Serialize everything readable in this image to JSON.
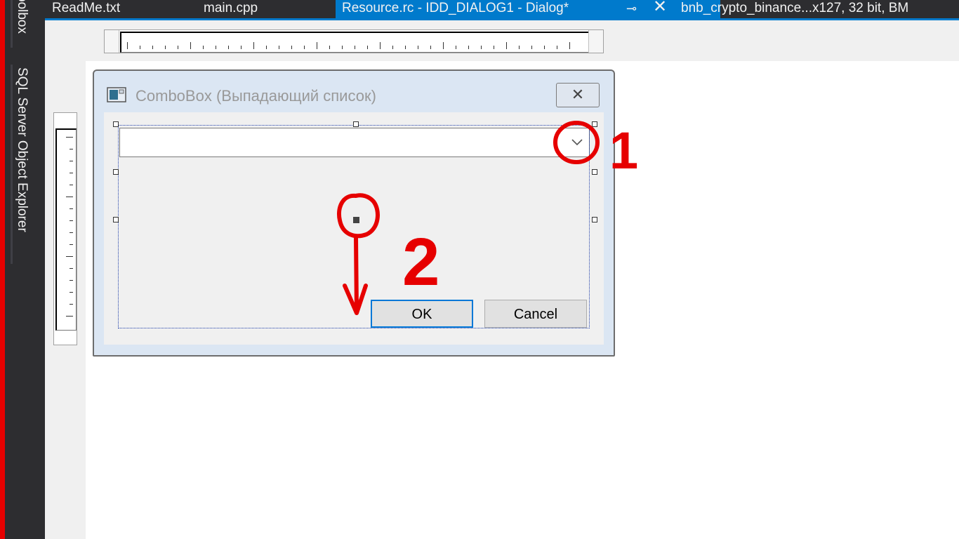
{
  "side_tabs": {
    "toolbox": "oolbox",
    "sql_server_object_explorer": "SQL Server Object Explorer"
  },
  "doc_tabs": {
    "readme": "ReadMe.txt",
    "main_cpp": "main.cpp",
    "resource": "Resource.rc - IDD_DIALOG1 - Dialog*",
    "resource_pin": "⊸",
    "resource_close": "✕",
    "bnb": "bnb_crypto_binance...x127, 32 bit, BM"
  },
  "dialog": {
    "title": "ComboBox (Выпадающий список)",
    "close_glyph": "✕",
    "ok_label": "OK",
    "cancel_label": "Cancel"
  },
  "annotations": {
    "mark_1": "1",
    "mark_2": "2"
  },
  "colors": {
    "accent_tab": "#007acc",
    "annotation": "#e60000",
    "focus_border": "#0078d7"
  }
}
